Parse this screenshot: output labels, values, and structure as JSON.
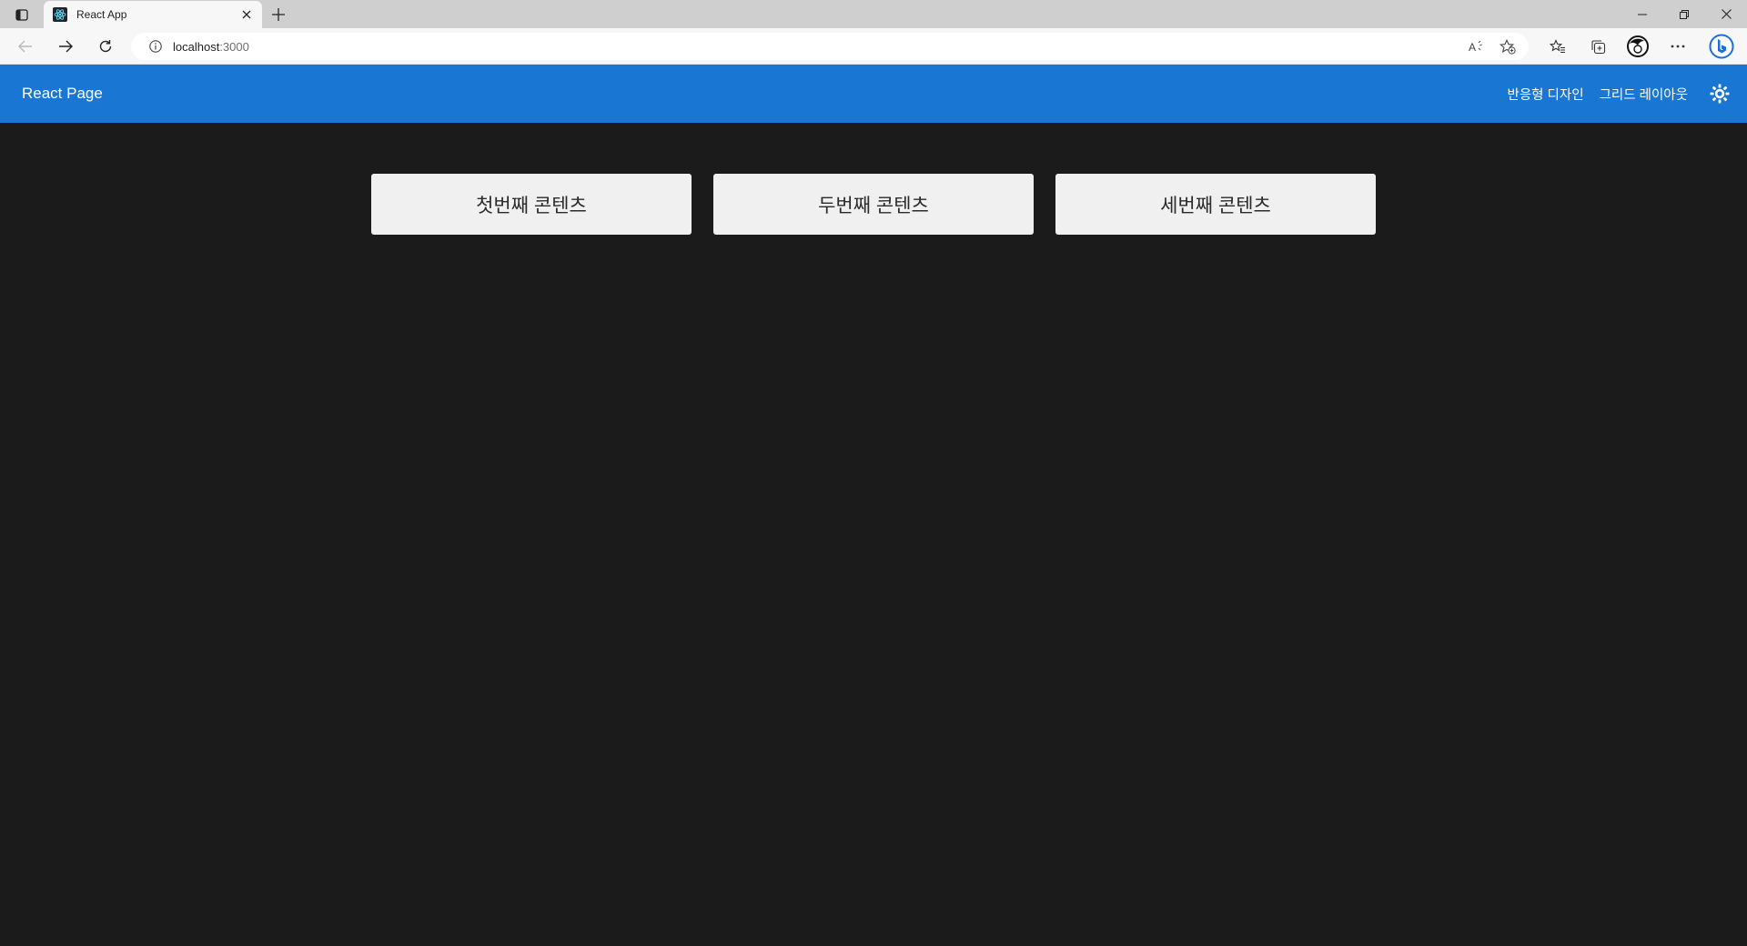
{
  "browser": {
    "tab": {
      "title": "React App",
      "favicon": "react-logo-icon"
    },
    "address": {
      "host": "localhost",
      "port": ":3000"
    },
    "icons": {
      "tab_actions": "tab-actions-icon",
      "new_tab": "plus-icon",
      "back": "back-arrow-icon",
      "forward": "forward-arrow-icon",
      "refresh": "refresh-icon",
      "site_info": "info-icon",
      "read_aloud": "read-aloud-icon",
      "add_favorite": "star-plus-icon",
      "favorites": "favorites-icon",
      "collections": "collections-icon",
      "profile": "profile-avatar-icon",
      "more": "more-icon",
      "copilot": "bing-icon"
    }
  },
  "app": {
    "brand": "React Page",
    "nav": [
      "반응형 디자인",
      "그리드 레이아웃"
    ],
    "theme_toggle_icon": "sun-icon",
    "header_color": "#1976d2",
    "background_color": "#1b1b1b"
  },
  "cards": [
    {
      "label": "첫번째 콘텐츠"
    },
    {
      "label": "두번째 콘텐츠"
    },
    {
      "label": "세번째 콘텐츠"
    }
  ]
}
